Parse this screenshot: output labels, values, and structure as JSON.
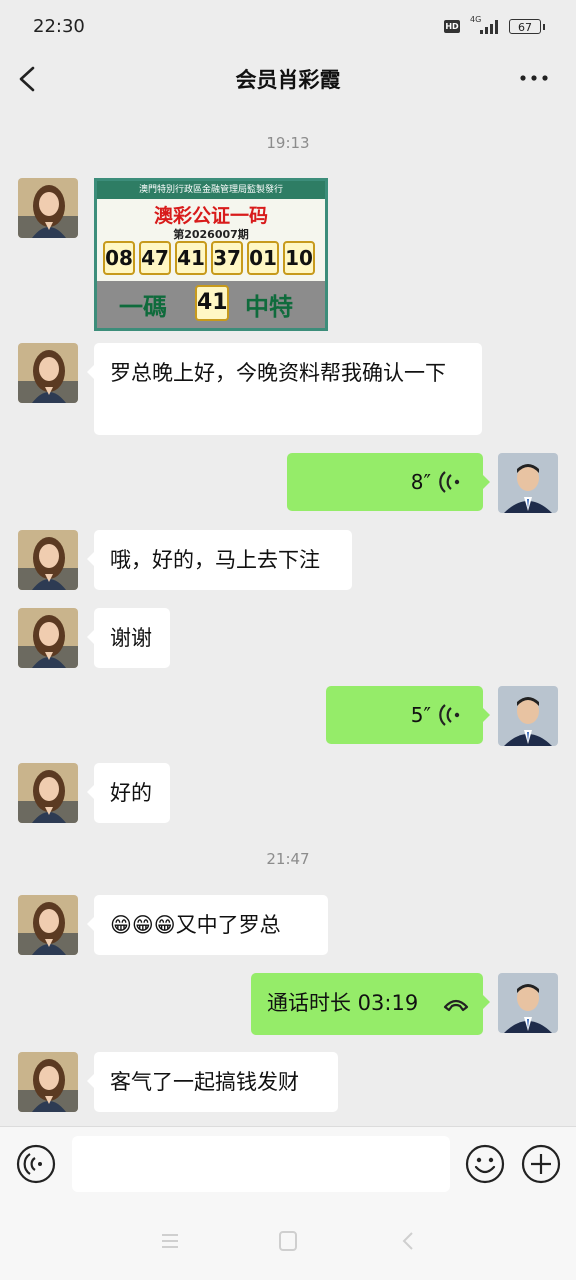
{
  "status_bar": {
    "time": "22:30",
    "hd": "HD",
    "network": "4G",
    "battery": "67"
  },
  "header": {
    "title": "会员肖彩霞"
  },
  "timestamps": [
    "19:13",
    "21:47"
  ],
  "lottery_card": {
    "issuer": "澳門特別行政區金融管理局監製發行",
    "title": "澳彩公证一码",
    "period": "第2026007期",
    "numbers": [
      "08",
      "47",
      "41",
      "37",
      "01",
      "10"
    ],
    "banner_left": "一碼",
    "banner_number": "41",
    "banner_right": "中特"
  },
  "messages": {
    "m1": "罗总晚上好，今晚资料帮我确认一下",
    "m2_duration": "8″",
    "m3": "哦，好的，马上去下注",
    "m4": "谢谢",
    "m5_duration": "5″",
    "m6": "好的",
    "m7_emoji": "😁😁😁",
    "m7_text": "又中了罗总",
    "m8_call": "通话时长 03:19",
    "m9": "客气了一起搞钱发财"
  },
  "colors": {
    "bubble_self": "#95ec69",
    "bubble_other": "#ffffff",
    "background": "#ededed"
  }
}
